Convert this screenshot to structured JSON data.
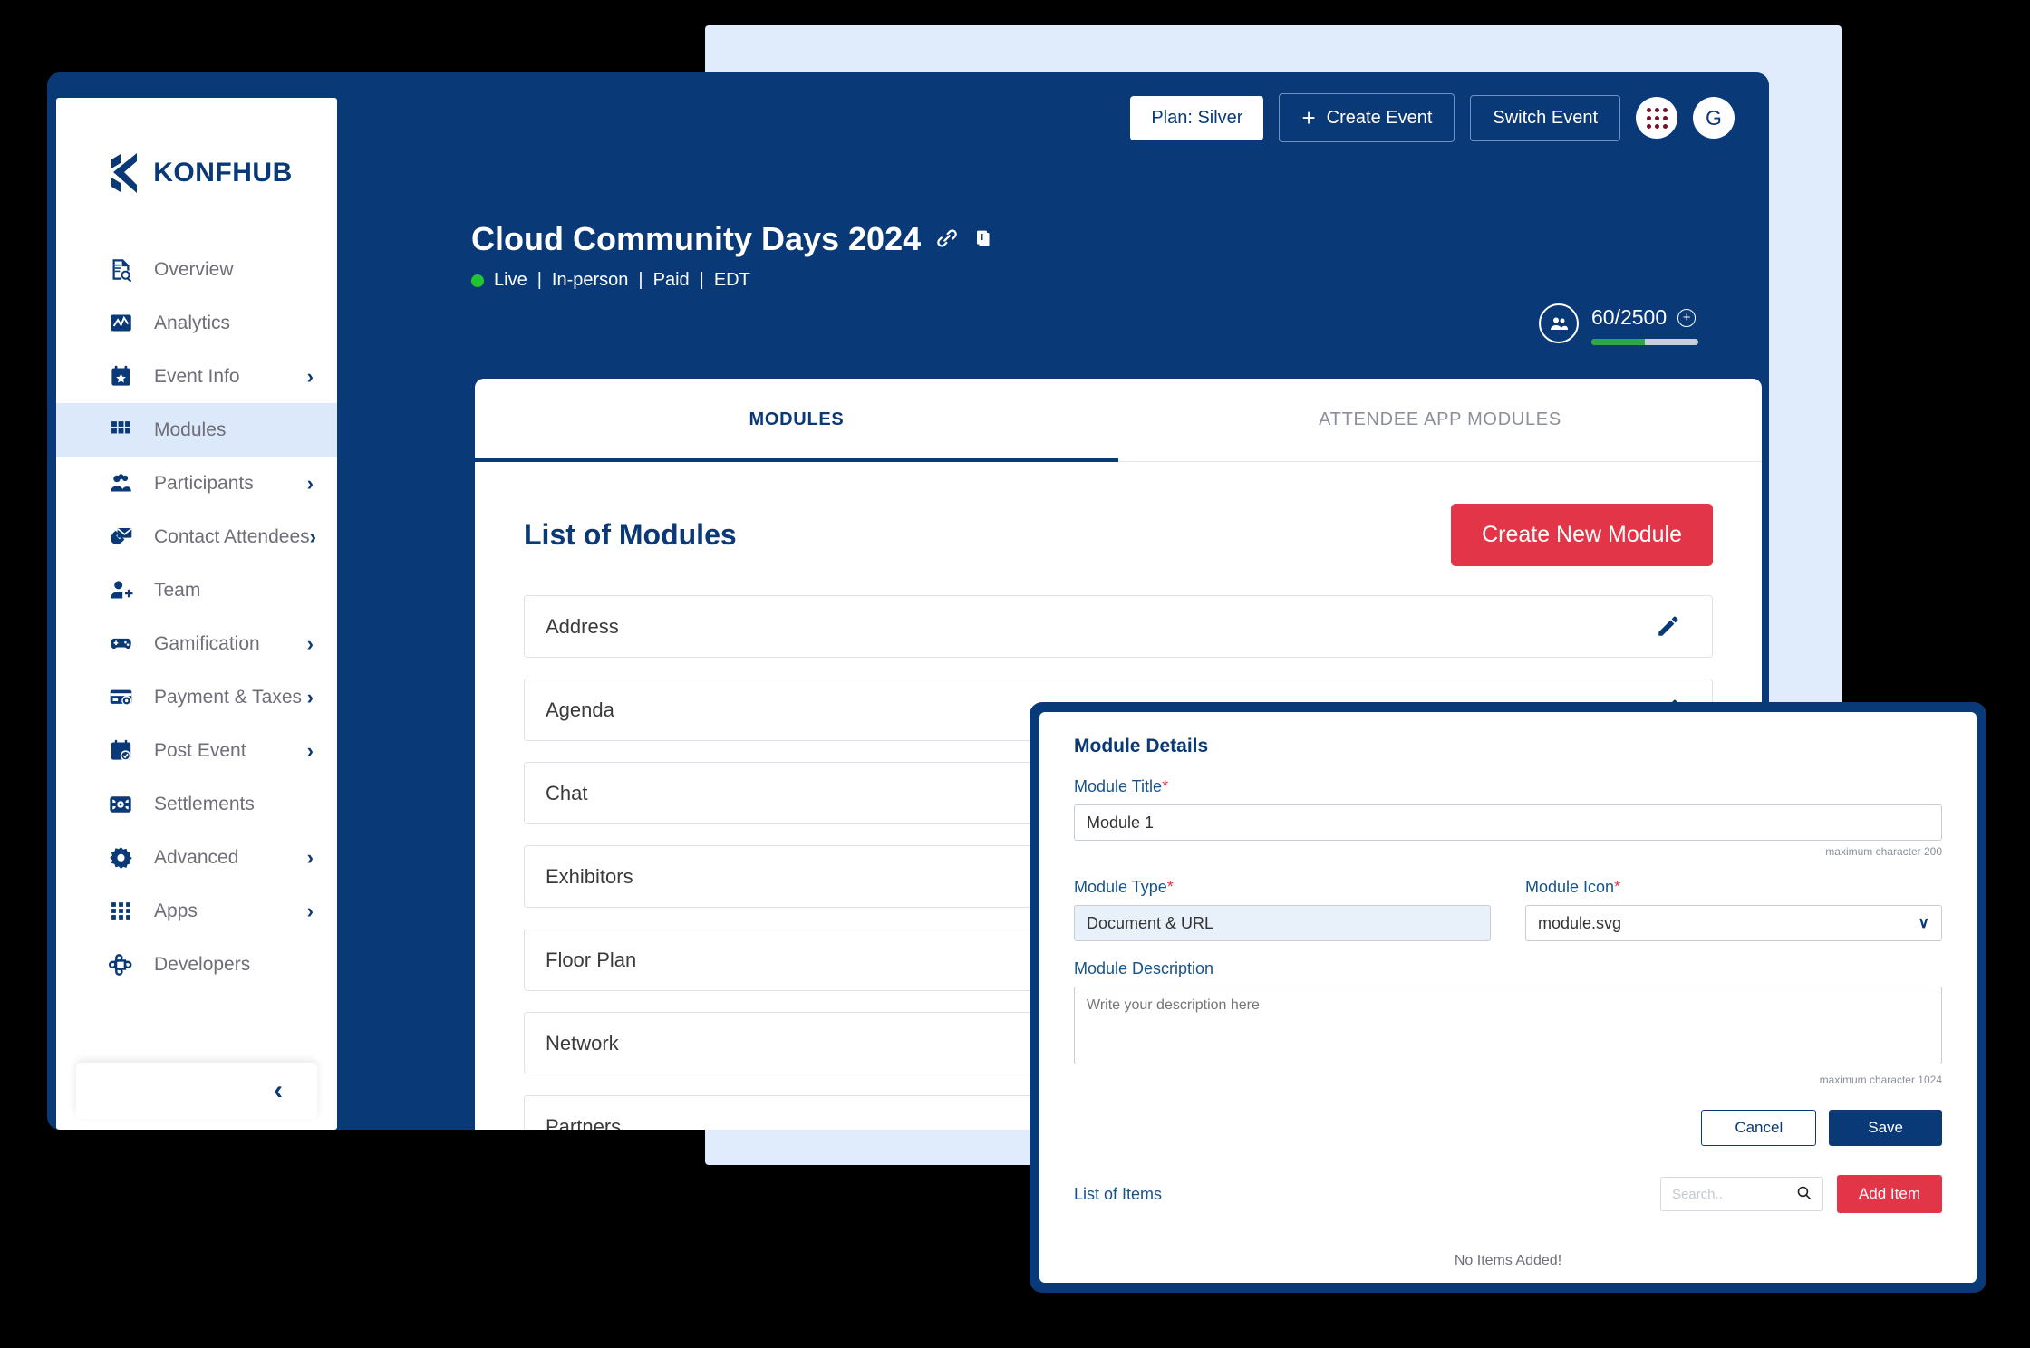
{
  "brand": {
    "name": "KONFHUB",
    "primary": "#0a3977",
    "accent_red": "#e23547",
    "panel_blue": "#e0ecfb"
  },
  "sidebar": {
    "items": [
      {
        "label": "Overview",
        "icon": "document-search-icon",
        "chevron": "",
        "active": false
      },
      {
        "label": "Analytics",
        "icon": "chart-line-icon",
        "chevron": "",
        "active": false
      },
      {
        "label": "Event Info",
        "icon": "calendar-star-icon",
        "chevron": "›",
        "active": false
      },
      {
        "label": "Modules",
        "icon": "grid-icon",
        "chevron": "",
        "active": true
      },
      {
        "label": "Participants",
        "icon": "people-group-icon",
        "chevron": "›",
        "active": false
      },
      {
        "label": "Contact Attendees",
        "icon": "mail-phone-icon",
        "chevron": "›",
        "active": false
      },
      {
        "label": "Team",
        "icon": "user-plus-icon",
        "chevron": "",
        "active": false
      },
      {
        "label": "Gamification",
        "icon": "gamepad-icon",
        "chevron": "›",
        "active": false
      },
      {
        "label": "Payment & Taxes",
        "icon": "credit-card-icon",
        "chevron": "›",
        "active": false
      },
      {
        "label": "Post Event",
        "icon": "calendar-check-icon",
        "chevron": "›",
        "active": false
      },
      {
        "label": "Settlements",
        "icon": "settlement-icon",
        "chevron": "",
        "active": false
      },
      {
        "label": "Advanced",
        "icon": "gear-icon",
        "chevron": "›",
        "active": false
      },
      {
        "label": "Apps",
        "icon": "apps-grid-icon",
        "chevron": "›",
        "active": false
      },
      {
        "label": "Developers",
        "icon": "developers-icon",
        "chevron": "",
        "active": false
      }
    ],
    "collapse_chevron": "‹"
  },
  "topbar": {
    "plan_label": "Plan: Silver",
    "create_event_label": "Create Event",
    "switch_event_label": "Switch Event",
    "apps_icon": "grid-apps-icon",
    "avatar_letter": "G"
  },
  "event": {
    "title": "Cloud Community Days 2024",
    "link_icon": "link-icon",
    "copy_icon": "copy-icon",
    "status": "Live",
    "mode": "In-person",
    "pricing": "Paid",
    "timezone": "EDT",
    "meta_sep": "|"
  },
  "attendees": {
    "icon": "people-icon",
    "count_text": "60/2500",
    "current": 60,
    "max": 2500,
    "percent": 50,
    "add_icon": "plus-circle-icon"
  },
  "tabs": [
    {
      "label": "MODULES",
      "active": true
    },
    {
      "label": "ATTENDEE APP MODULES",
      "active": false
    }
  ],
  "modules_page": {
    "list_title": "List of Modules",
    "create_button": "Create New Module",
    "edit_icon": "pencil-icon",
    "rows": [
      {
        "name": "Address"
      },
      {
        "name": "Agenda"
      },
      {
        "name": "Chat"
      },
      {
        "name": "Exhibitors"
      },
      {
        "name": "Floor Plan"
      },
      {
        "name": "Network"
      },
      {
        "name": "Partners"
      },
      {
        "name": ""
      }
    ]
  },
  "modal": {
    "heading": "Module Details",
    "title_label": "Module Title",
    "title_value": "Module 1",
    "title_helper": "maximum character 200",
    "type_label": "Module Type",
    "type_value": "Document & URL",
    "icon_label": "Module Icon",
    "icon_value": "module.svg",
    "icon_chevron": "∨",
    "description_label": "Module Description",
    "description_placeholder": "Write your description here",
    "description_helper": "maximum character 1024",
    "cancel_label": "Cancel",
    "save_label": "Save",
    "items_title": "List of Items",
    "search_placeholder": "Search..",
    "search_icon": "search-icon",
    "add_item_label": "Add Item",
    "empty_text": "No Items Added!",
    "required_marker": "*"
  }
}
